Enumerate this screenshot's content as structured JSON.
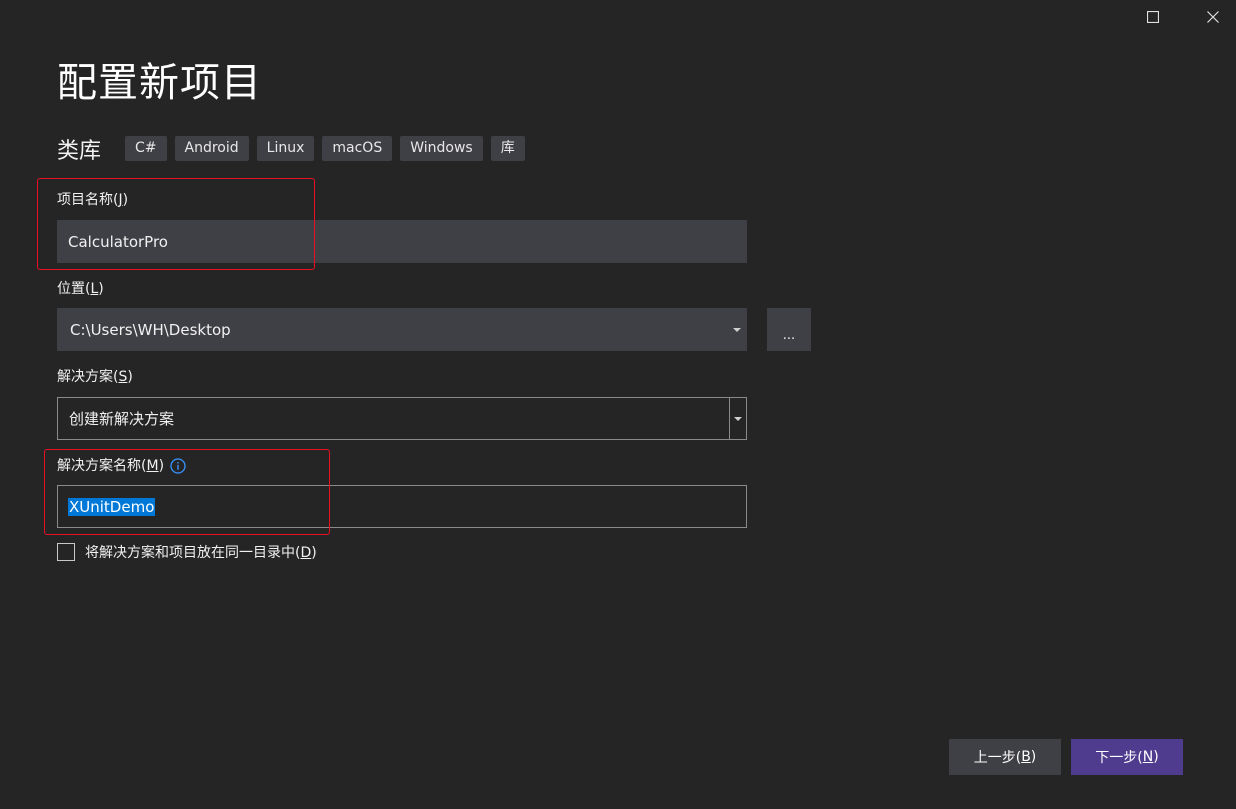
{
  "window": {
    "maximize_icon": "maximize-icon",
    "close_icon": "close-icon"
  },
  "page": {
    "title": "配置新项目"
  },
  "template": {
    "name": "类库",
    "tags": [
      "C#",
      "Android",
      "Linux",
      "macOS",
      "Windows",
      "库"
    ]
  },
  "project_name": {
    "label_text": "项目名称(",
    "label_key": "J",
    "label_end": ")",
    "value": "CalculatorPro"
  },
  "location": {
    "label_text": "位置(",
    "label_key": "L",
    "label_end": ")",
    "value": "C:\\Users\\WH\\Desktop",
    "browse_label": "..."
  },
  "solution": {
    "label_text": "解决方案(",
    "label_key": "S",
    "label_end": ")",
    "value": "创建新解决方案"
  },
  "solution_name": {
    "label_text": "解决方案名称(",
    "label_key": "M",
    "label_end": ")",
    "value": "XUnitDemo",
    "info_icon": "info-icon"
  },
  "same_directory": {
    "label_text": "将解决方案和项目放在同一目录中(",
    "label_key": "D",
    "label_end": ")",
    "checked": false
  },
  "footer": {
    "back_text": "上一步(",
    "back_key": "B",
    "back_end": ")",
    "next_text": "下一步(",
    "next_key": "N",
    "next_end": ")"
  },
  "colors": {
    "background": "#252526",
    "field": "#3f3f46",
    "accent": "#4f3c8f",
    "selection": "#0078d7",
    "highlight_box": "#e81123",
    "info": "#3794ff"
  }
}
